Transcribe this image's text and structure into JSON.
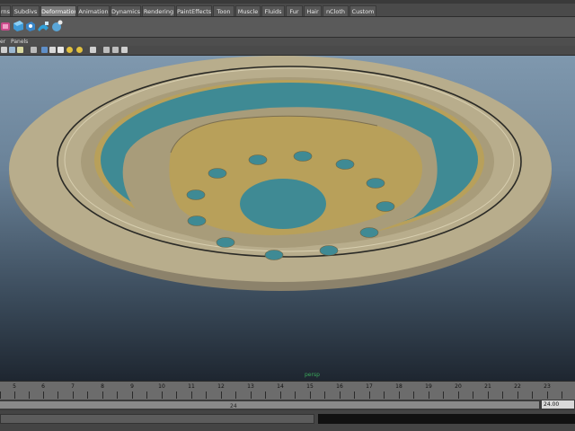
{
  "shelf": {
    "tabs": [
      {
        "label": "rns"
      },
      {
        "label": "Subdivs"
      },
      {
        "label": "Deformation",
        "active": true
      },
      {
        "label": "Animation"
      },
      {
        "label": "Dynamics"
      },
      {
        "label": "Rendering"
      },
      {
        "label": "PaintEffects"
      },
      {
        "label": "Toon"
      },
      {
        "label": "Muscle"
      },
      {
        "label": "Fluids"
      },
      {
        "label": "Fur"
      },
      {
        "label": "Hair"
      },
      {
        "label": "nCloth"
      },
      {
        "label": "Custom"
      }
    ],
    "icons": [
      "deformer-icon",
      "lattice-icon",
      "cluster-icon",
      "wrap-icon",
      "sculpt-icon"
    ]
  },
  "panel_menu": {
    "items": [
      "er",
      "Panels"
    ]
  },
  "viewport": {
    "camera_label": "persp",
    "colors": {
      "outer_rim": "#b8ad8c",
      "teal": "#3f8a94",
      "gold": "#b8a05a",
      "beige": "#a89c7a"
    }
  },
  "time_slider": {
    "ticks": [
      "5",
      "6",
      "7",
      "8",
      "9",
      "10",
      "11",
      "12",
      "13",
      "14",
      "15",
      "16",
      "17",
      "18",
      "19",
      "20",
      "21",
      "22",
      "23"
    ]
  },
  "range_slider": {
    "current": "24",
    "end": "24.00"
  }
}
